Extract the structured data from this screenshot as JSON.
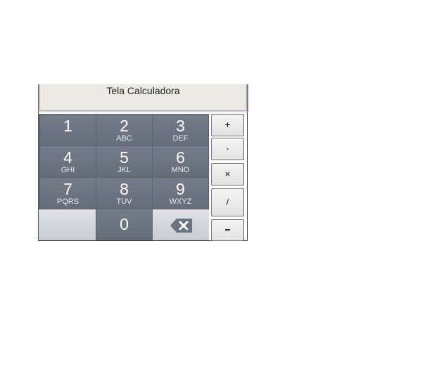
{
  "screen": {
    "label": "Tela Calculadora"
  },
  "keypad": {
    "keys": [
      {
        "digit": "1",
        "letters": ""
      },
      {
        "digit": "2",
        "letters": "ABC"
      },
      {
        "digit": "3",
        "letters": "DEF"
      },
      {
        "digit": "4",
        "letters": "GHI"
      },
      {
        "digit": "5",
        "letters": "JKL"
      },
      {
        "digit": "6",
        "letters": "MNO"
      },
      {
        "digit": "7",
        "letters": "PQRS"
      },
      {
        "digit": "8",
        "letters": "TUV"
      },
      {
        "digit": "9",
        "letters": "WXYZ"
      },
      {
        "digit": "0",
        "letters": ""
      }
    ],
    "backspace_icon": "backspace-icon"
  },
  "operators": {
    "plus": "+",
    "minus": "-",
    "multiply": "×",
    "divide": "/",
    "equals": "="
  },
  "colors": {
    "screen_bg": "#ebe9e3",
    "key_bg": "#6e7582",
    "key_light_bg": "#d4d6db"
  }
}
